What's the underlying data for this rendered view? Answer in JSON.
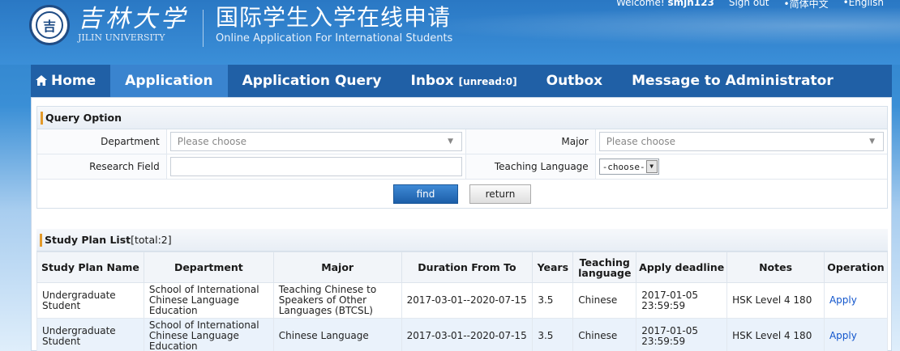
{
  "header": {
    "logo_cn": "吉林大学",
    "logo_en": "JILIN UNIVERSITY",
    "title_cn": "国际学生入学在线申请",
    "title_en": "Online Application For International Students",
    "welcome": "Welcome!",
    "username": "smjh123",
    "sign_out": "Sign out",
    "lang_cn": "•简体中文",
    "lang_en": "•English"
  },
  "nav": {
    "home": "Home",
    "application": "Application",
    "application_query": "Application Query",
    "inbox": "Inbox",
    "inbox_unread": "[unread:0]",
    "outbox": "Outbox",
    "message_admin": "Message to Administrator"
  },
  "query": {
    "section_title": "Query Option",
    "department_label": "Department",
    "department_placeholder": "Please choose",
    "major_label": "Major",
    "major_placeholder": "Please choose",
    "research_label": "Research Field",
    "research_value": "",
    "teaching_lang_label": "Teaching Language",
    "teaching_lang_value": "-choose-",
    "find_button": "find",
    "return_button": "return"
  },
  "plans": {
    "section_title": "Study Plan List",
    "total": "[total:2]",
    "columns": [
      "Study Plan Name",
      "Department",
      "Major",
      "Duration From To",
      "Years",
      "Teaching language",
      "Apply deadline",
      "Notes",
      "Operation"
    ],
    "rows": [
      {
        "name": "Undergraduate Student",
        "department": "School of International Chinese Language Education",
        "major": "Teaching Chinese to Speakers of Other Languages (BTCSL)",
        "duration": "2017-03-01--2020-07-15",
        "years": "3.5",
        "language": "Chinese",
        "deadline": "2017-01-05 23:59:59",
        "notes": "HSK Level 4 180",
        "operation": "Apply"
      },
      {
        "name": "Undergraduate Student",
        "department": "School of International Chinese Language Education",
        "major": "Chinese Language",
        "duration": "2017-03-01--2020-07-15",
        "years": "3.5",
        "language": "Chinese",
        "deadline": "2017-01-05 23:59:59",
        "notes": "HSK Level 4 180",
        "operation": "Apply"
      }
    ]
  }
}
